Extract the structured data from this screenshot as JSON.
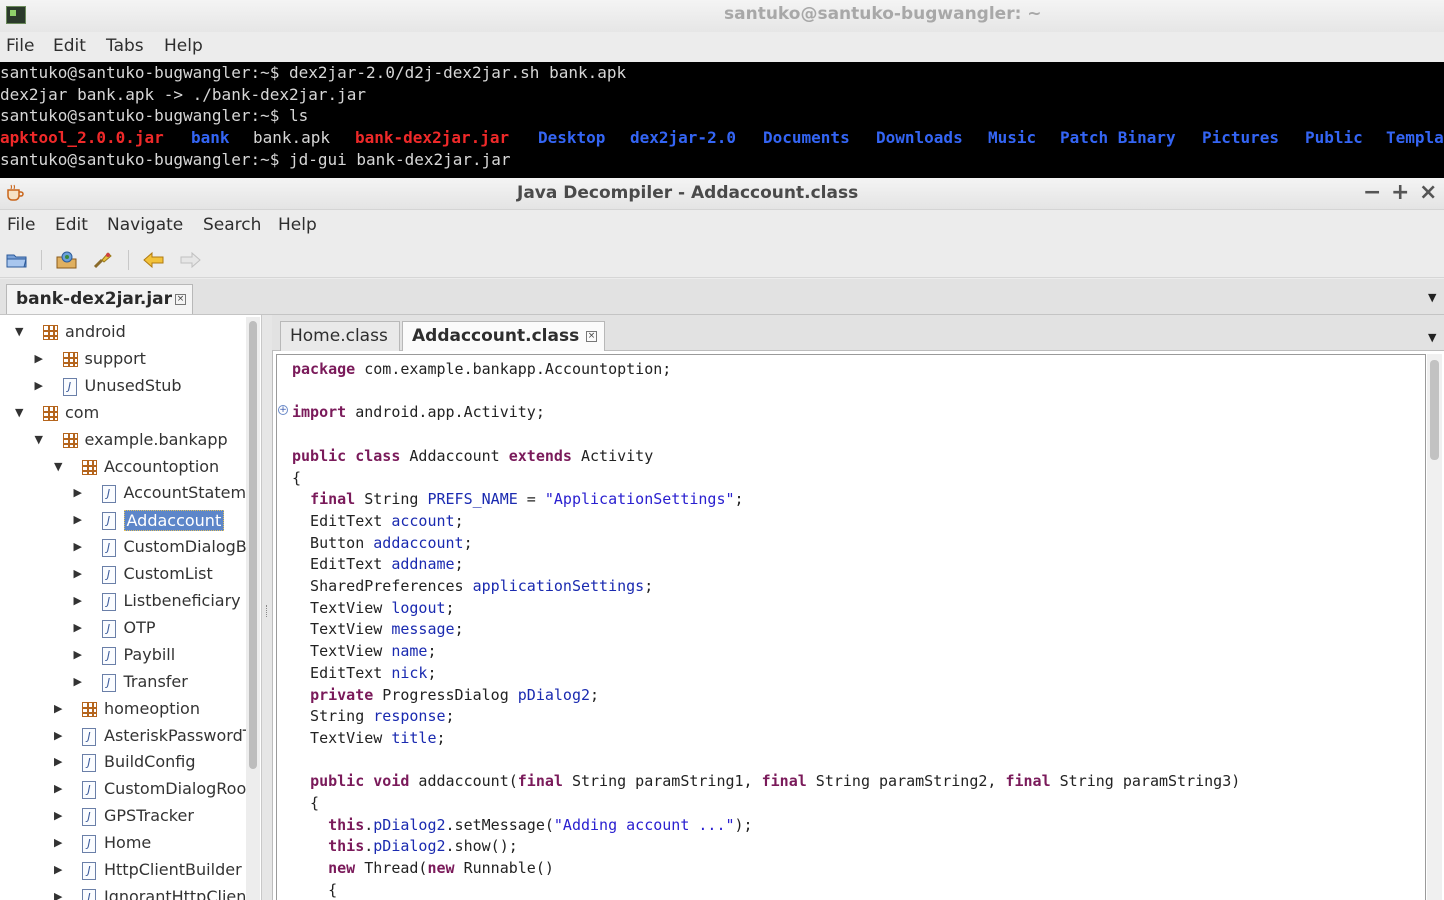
{
  "terminal": {
    "title": "santuko@santuko-bugwangler: ~",
    "menu": [
      "File",
      "Edit",
      "Tabs",
      "Help"
    ],
    "lines": [
      "santuko@santuko-bugwangler:~$ dex2jar-2.0/d2j-dex2jar.sh bank.apk",
      "dex2jar bank.apk -> ./bank-dex2jar.jar",
      "santuko@santuko-bugwangler:~$ ls",
      "",
      "santuko@santuko-bugwangler:~$ jd-gui bank-dex2jar.jar"
    ],
    "ls_items": [
      {
        "text": "apktool_2.0.0.jar",
        "color": "#ef2929"
      },
      {
        "text": "bank",
        "color": "#3465f4"
      },
      {
        "text": "bank.apk",
        "color": "#d7d7d7"
      },
      {
        "text": "bank-dex2jar.jar",
        "color": "#ef2929"
      },
      {
        "text": "Desktop",
        "color": "#3465f4"
      },
      {
        "text": "dex2jar-2.0",
        "color": "#3465f4"
      },
      {
        "text": "Documents",
        "color": "#3465f4"
      },
      {
        "text": "Downloads",
        "color": "#3465f4"
      },
      {
        "text": "Music",
        "color": "#3465f4"
      },
      {
        "text": "Patch Binary",
        "color": "#3465f4"
      },
      {
        "text": "Pictures",
        "color": "#3465f4"
      },
      {
        "text": "Public",
        "color": "#3465f4"
      },
      {
        "text": "Templa",
        "color": "#3465f4"
      }
    ]
  },
  "jdgui": {
    "title": "Java Decompiler - Addaccount.class",
    "window_controls": [
      "−",
      "+",
      "×"
    ],
    "menu": [
      "File",
      "Edit",
      "Navigate",
      "Search",
      "Help"
    ],
    "toolbar": [
      "open-icon",
      "open-type-icon",
      "search-icon",
      "back-icon",
      "forward-icon"
    ],
    "file_tab": "bank-dex2jar.jar",
    "tree": [
      {
        "label": "android",
        "kind": "package",
        "depth": 0,
        "arrow": "down"
      },
      {
        "label": "support",
        "kind": "package",
        "depth": 1,
        "arrow": "right"
      },
      {
        "label": "UnusedStub",
        "kind": "class",
        "depth": 1,
        "arrow": "right"
      },
      {
        "label": "com",
        "kind": "package",
        "depth": 0,
        "arrow": "down"
      },
      {
        "label": "example.bankapp",
        "kind": "package",
        "depth": 1,
        "arrow": "down"
      },
      {
        "label": "Accountoption",
        "kind": "package",
        "depth": 2,
        "arrow": "down"
      },
      {
        "label": "AccountStatem",
        "kind": "class",
        "depth": 3,
        "arrow": "right"
      },
      {
        "label": "Addaccount",
        "kind": "class",
        "depth": 3,
        "arrow": "right",
        "selected": true
      },
      {
        "label": "CustomDialogBe",
        "kind": "class",
        "depth": 3,
        "arrow": "right"
      },
      {
        "label": "CustomList",
        "kind": "class",
        "depth": 3,
        "arrow": "right"
      },
      {
        "label": "Listbeneficiary",
        "kind": "class",
        "depth": 3,
        "arrow": "right"
      },
      {
        "label": "OTP",
        "kind": "class",
        "depth": 3,
        "arrow": "right"
      },
      {
        "label": "Paybill",
        "kind": "class",
        "depth": 3,
        "arrow": "right"
      },
      {
        "label": "Transfer",
        "kind": "class",
        "depth": 3,
        "arrow": "right"
      },
      {
        "label": "homeoption",
        "kind": "package",
        "depth": 2,
        "arrow": "right"
      },
      {
        "label": "AsteriskPasswordTr",
        "kind": "class",
        "depth": 2,
        "arrow": "right"
      },
      {
        "label": "BuildConfig",
        "kind": "class",
        "depth": 2,
        "arrow": "right"
      },
      {
        "label": "CustomDialogRoot",
        "kind": "class",
        "depth": 2,
        "arrow": "right"
      },
      {
        "label": "GPSTracker",
        "kind": "class",
        "depth": 2,
        "arrow": "right"
      },
      {
        "label": "Home",
        "kind": "class",
        "depth": 2,
        "arrow": "right"
      },
      {
        "label": "HttpClientBuilder",
        "kind": "class",
        "depth": 2,
        "arrow": "right"
      },
      {
        "label": "IgnorantHttpClient",
        "kind": "class",
        "depth": 2,
        "arrow": "right"
      }
    ],
    "code_tabs": [
      {
        "label": "Home.class",
        "active": false
      },
      {
        "label": "Addaccount.class",
        "active": true
      }
    ],
    "code": [
      [
        [
          "kw",
          "package"
        ],
        [
          "t",
          " com.example.bankapp.Accountoption;"
        ]
      ],
      [],
      [
        [
          "kw",
          "import"
        ],
        [
          "t",
          " android.app.Activity;"
        ]
      ],
      [],
      [
        [
          "kw",
          "public class"
        ],
        [
          "t",
          " Addaccount "
        ],
        [
          "kw",
          "extends"
        ],
        [
          "t",
          " Activity"
        ]
      ],
      [
        [
          "t",
          "{"
        ]
      ],
      [
        [
          "t",
          "  "
        ],
        [
          "kw",
          "final"
        ],
        [
          "t",
          " String "
        ],
        [
          "fld",
          "PREFS_NAME"
        ],
        [
          "t",
          " = "
        ],
        [
          "str",
          "\"ApplicationSettings\""
        ],
        [
          "t",
          ";"
        ]
      ],
      [
        [
          "t",
          "  EditText "
        ],
        [
          "fld",
          "account"
        ],
        [
          "t",
          ";"
        ]
      ],
      [
        [
          "t",
          "  Button "
        ],
        [
          "fld",
          "addaccount"
        ],
        [
          "t",
          ";"
        ]
      ],
      [
        [
          "t",
          "  EditText "
        ],
        [
          "fld",
          "addname"
        ],
        [
          "t",
          ";"
        ]
      ],
      [
        [
          "t",
          "  SharedPreferences "
        ],
        [
          "fld",
          "applicationSettings"
        ],
        [
          "t",
          ";"
        ]
      ],
      [
        [
          "t",
          "  TextView "
        ],
        [
          "fld",
          "logout"
        ],
        [
          "t",
          ";"
        ]
      ],
      [
        [
          "t",
          "  TextView "
        ],
        [
          "fld",
          "message"
        ],
        [
          "t",
          ";"
        ]
      ],
      [
        [
          "t",
          "  TextView "
        ],
        [
          "fld",
          "name"
        ],
        [
          "t",
          ";"
        ]
      ],
      [
        [
          "t",
          "  EditText "
        ],
        [
          "fld",
          "nick"
        ],
        [
          "t",
          ";"
        ]
      ],
      [
        [
          "t",
          "  "
        ],
        [
          "kw",
          "private"
        ],
        [
          "t",
          " ProgressDialog "
        ],
        [
          "fld",
          "pDialog2"
        ],
        [
          "t",
          ";"
        ]
      ],
      [
        [
          "t",
          "  String "
        ],
        [
          "fld",
          "response"
        ],
        [
          "t",
          ";"
        ]
      ],
      [
        [
          "t",
          "  TextView "
        ],
        [
          "fld",
          "title"
        ],
        [
          "t",
          ";"
        ]
      ],
      [],
      [
        [
          "t",
          "  "
        ],
        [
          "kw",
          "public void"
        ],
        [
          "t",
          " addaccount("
        ],
        [
          "kw",
          "final"
        ],
        [
          "t",
          " String paramString1, "
        ],
        [
          "kw",
          "final"
        ],
        [
          "t",
          " String paramString2, "
        ],
        [
          "kw",
          "final"
        ],
        [
          "t",
          " String paramString3)"
        ]
      ],
      [
        [
          "t",
          "  {"
        ]
      ],
      [
        [
          "t",
          "    "
        ],
        [
          "kw",
          "this"
        ],
        [
          "t",
          "."
        ],
        [
          "fld",
          "pDialog2"
        ],
        [
          "t",
          ".setMessage("
        ],
        [
          "str",
          "\"Adding account ...\""
        ],
        [
          "t",
          ");"
        ]
      ],
      [
        [
          "t",
          "    "
        ],
        [
          "kw",
          "this"
        ],
        [
          "t",
          "."
        ],
        [
          "fld",
          "pDialog2"
        ],
        [
          "t",
          ".show();"
        ]
      ],
      [
        [
          "t",
          "    "
        ],
        [
          "kw",
          "new"
        ],
        [
          "t",
          " Thread("
        ],
        [
          "kw",
          "new"
        ],
        [
          "t",
          " Runnable()"
        ]
      ],
      [
        [
          "t",
          "    {"
        ]
      ]
    ]
  }
}
